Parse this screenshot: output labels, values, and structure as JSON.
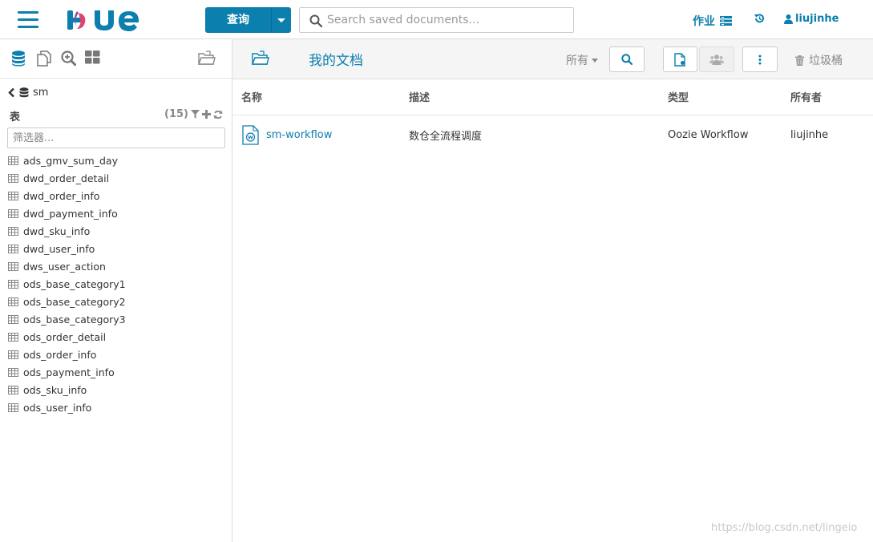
{
  "navbar": {
    "query_label": "查询",
    "search_placeholder": "Search saved documents...",
    "jobs_label": "作业",
    "user_label": "liujinhe",
    "brand_color": "#0b7fad"
  },
  "sidebar": {
    "database": "sm",
    "tables_title": "表",
    "tables_count": "(15)",
    "filter_placeholder": "筛选器...",
    "tables": [
      {
        "name": "ads_gmv_sum_day"
      },
      {
        "name": "dwd_order_detail"
      },
      {
        "name": "dwd_order_info"
      },
      {
        "name": "dwd_payment_info"
      },
      {
        "name": "dwd_sku_info"
      },
      {
        "name": "dwd_user_info"
      },
      {
        "name": "dws_user_action"
      },
      {
        "name": "ods_base_category1"
      },
      {
        "name": "ods_base_category2"
      },
      {
        "name": "ods_base_category3"
      },
      {
        "name": "ods_order_detail"
      },
      {
        "name": "ods_order_info"
      },
      {
        "name": "ods_payment_info"
      },
      {
        "name": "ods_sku_info"
      },
      {
        "name": "ods_user_info"
      }
    ]
  },
  "main": {
    "title": "我的文档",
    "owner_filter": "所有",
    "trash_label": "垃圾桶",
    "columns": {
      "name": "名称",
      "description": "描述",
      "type": "类型",
      "owner": "所有者"
    },
    "documents": [
      {
        "name": "sm-workflow",
        "description": "数仓全流程调度",
        "type": "Oozie Workflow",
        "owner": "liujinhe"
      }
    ]
  },
  "watermark": "https://blog.csdn.net/lingeio"
}
